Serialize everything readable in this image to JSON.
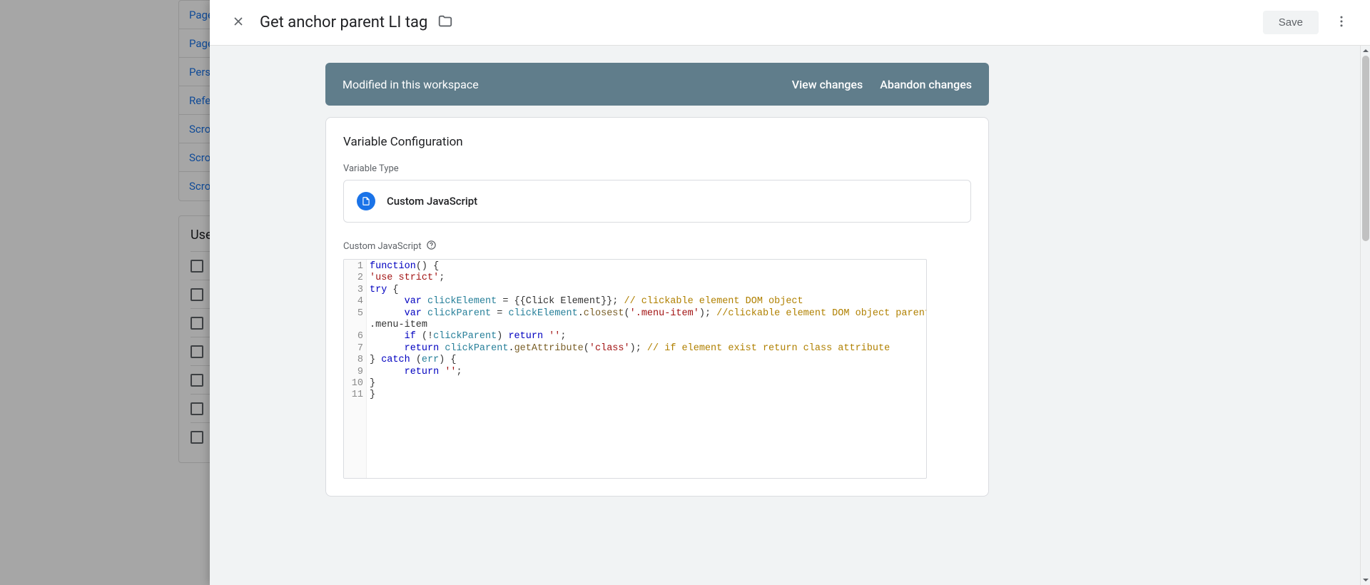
{
  "under": {
    "list": [
      "Pageview",
      "Pageview",
      "Personalization",
      "Referrer",
      "Scroll",
      "Scroll",
      "Scroll"
    ],
    "panel2_header": "User-Defined Variables"
  },
  "header": {
    "title": "Get anchor parent LI tag",
    "save_label": "Save"
  },
  "notice": {
    "text": "Modified in this workspace",
    "view_changes": "View changes",
    "abandon_changes": "Abandon changes"
  },
  "config": {
    "card_title": "Variable Configuration",
    "type_label": "Variable Type",
    "type_name": "Custom JavaScript",
    "code_label": "Custom JavaScript"
  },
  "code": {
    "lines": [
      "function() {",
      "'use strict';",
      "try {",
      "      var clickElement = {{Click Element}}; // clickable element DOM object",
      "      var clickParent = clickElement.closest('.menu-item'); //clickable element DOM object parent with class .menu-item",
      "      if (!clickParent) return '';",
      "      return clickParent.getAttribute('class'); // if element exist return class attribute",
      "} catch (err) {",
      "      return '';",
      "}",
      "}"
    ]
  }
}
